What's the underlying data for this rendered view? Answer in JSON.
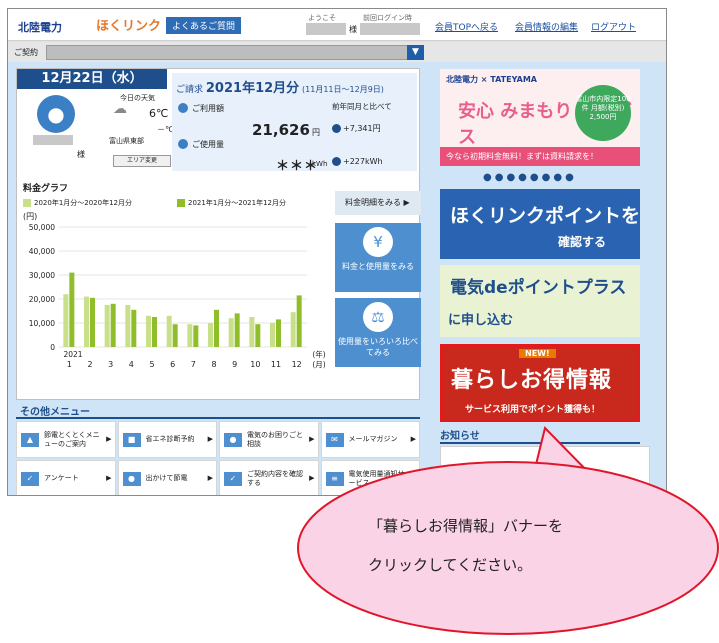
{
  "header": {
    "brand": "北陸電力",
    "service": "ほくリンク",
    "faq": "よくあるご質問",
    "welcome_label": "ようこそ",
    "welcome_suffix": "様",
    "last_login_label": "前回ログイン時",
    "links": [
      "会員TOPへ戻る",
      "会員情報の編集",
      "ログアウト"
    ]
  },
  "contract": {
    "label": "ご契約"
  },
  "summary": {
    "date": "12月22日（水）",
    "customer_suffix": "様",
    "weather_label": "今日の天気",
    "temp_high": "6℃",
    "temp_low": "－℃",
    "region": "富山県東部",
    "area_change": "エリア変更"
  },
  "billing": {
    "title_prefix": "ご請求",
    "title_month": "2021年12月分",
    "title_range": "(11月11日～12月9日)",
    "usage_fee_label": "ご利用額",
    "usage_fee": "21,626",
    "usage_fee_unit": "円",
    "usage_amount_label": "ご使用量",
    "usage_amount": "＊＊＊",
    "usage_amount_unit": "kWh",
    "compare_label": "前年同月と比べて",
    "compare_fee": "+7,341円",
    "compare_usage": "+227kWh"
  },
  "chart_section": {
    "title": "料金グラフ",
    "detail_button": "料金明細をみる",
    "btn_fee_usage": "料金と使用量をみる",
    "btn_compare": "使用量をいろいろ比べてみる"
  },
  "chart_data": {
    "type": "bar",
    "title": "",
    "ylabel": "(円)",
    "xlabel": "(月)",
    "ylim": [
      0,
      50000
    ],
    "yticks": [
      "50,000",
      "40,000",
      "30,000",
      "20,000",
      "10,000",
      "0"
    ],
    "categories": [
      "1",
      "2",
      "3",
      "4",
      "5",
      "6",
      "7",
      "8",
      "9",
      "10",
      "11",
      "12"
    ],
    "year_label": "2021",
    "year_suffix": "(年)",
    "series": [
      {
        "name": "2020年1月分～2020年12月分",
        "color": "#c9e08a",
        "values": [
          22000,
          21000,
          17500,
          17500,
          13000,
          13000,
          9500,
          10000,
          12000,
          12500,
          10000,
          14500
        ]
      },
      {
        "name": "2021年1月分～2021年12月分",
        "color": "#8fbe2a",
        "values": [
          31000,
          20500,
          18000,
          15500,
          12500,
          9500,
          9000,
          15500,
          14000,
          9500,
          11500,
          21500
        ]
      }
    ]
  },
  "other_menu": {
    "title": "その他メニュー",
    "items": [
      {
        "label": "節電とくとくメニューのご案内",
        "icon": "chart-icon"
      },
      {
        "label": "省エネ診断予約",
        "icon": "meter-icon"
      },
      {
        "label": "電気のお困りごと相談",
        "icon": "chat-icon"
      },
      {
        "label": "メールマガジン",
        "icon": "mail-icon"
      },
      {
        "label": "アンケート",
        "icon": "survey-icon"
      },
      {
        "label": "出かけて節電",
        "icon": "walk-icon"
      },
      {
        "label": "ご契約内容を確認する",
        "icon": "doc-icon"
      },
      {
        "label": "電気使用量通知サービス",
        "icon": "list-icon"
      }
    ]
  },
  "banners": {
    "anshin_top": "北陸電力 × TATEYAMA",
    "anshin_main": "安心 みまもり サービス",
    "anshin_circle": "富山市内限定100件 月額(税別) 2,500円",
    "anshin_bar": "今なら初期料金無料！まずは資料請求を！",
    "point_main": "ほくリンクポイントを",
    "point_sub": "確認する",
    "plus_main": "電気deポイントプラス",
    "plus_sub": "に申し込む",
    "kurashi_new": "NEW!",
    "kurashi_main": "暮らしお得情報",
    "kurashi_sub": "サービス利用でポイント獲得も！"
  },
  "news": {
    "title": "お知らせ"
  },
  "callout": {
    "line1": "「暮らしお得情報」バナーを",
    "line2": "クリックしてください。"
  }
}
